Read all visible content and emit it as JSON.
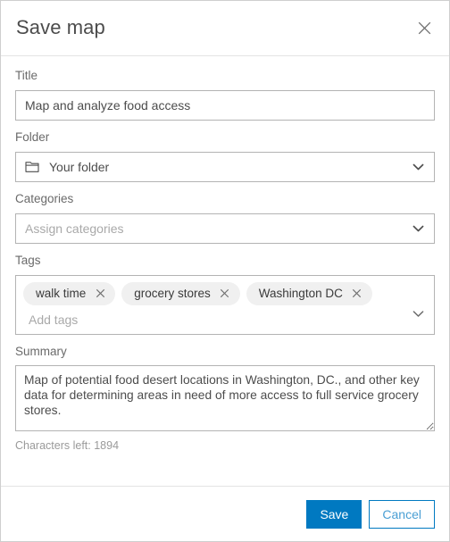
{
  "dialog": {
    "title": "Save map",
    "close_icon": "close-icon"
  },
  "fields": {
    "title": {
      "label": "Title",
      "value": "Map and analyze food access",
      "placeholder": "Title"
    },
    "folder": {
      "label": "Folder",
      "value": "Your folder",
      "icon": "folder-icon",
      "chevron": "chevron-down-icon"
    },
    "categories": {
      "label": "Categories",
      "value": "",
      "placeholder": "Assign categories",
      "chevron": "chevron-down-icon"
    },
    "tags": {
      "label": "Tags",
      "chips": [
        {
          "label": "walk time",
          "remove_icon": "close-icon"
        },
        {
          "label": "grocery stores",
          "remove_icon": "close-icon"
        },
        {
          "label": "Washington DC",
          "remove_icon": "close-icon"
        }
      ],
      "input_value": "",
      "placeholder": "Add tags",
      "chevron": "chevron-down-icon"
    },
    "summary": {
      "label": "Summary",
      "value": "Map of potential food desert locations in Washington, DC., and other key data for determining areas in need of more access to full service grocery stores.",
      "characters_left": "Characters left: 1894"
    }
  },
  "footer": {
    "save_label": "Save",
    "cancel_label": "Cancel"
  },
  "colors": {
    "primary": "#0079c1",
    "secondary_text": "#4a9fd4",
    "border": "#b3b3b3",
    "label_text": "#6a6a6a",
    "chip_bg": "#f0f0f0"
  }
}
